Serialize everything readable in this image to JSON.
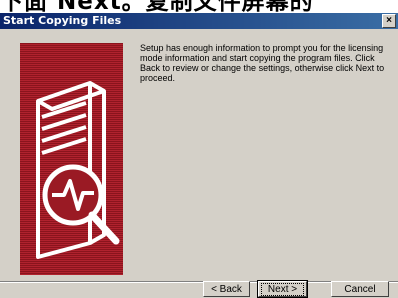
{
  "background_caption": "下面 Next。复制文件屏幕的",
  "window": {
    "title": "Start Copying Files",
    "close_glyph": "×"
  },
  "description": "Setup has enough information to prompt you for the licensing mode information and start copying the program files.  Click Back to review or change the settings, otherwise click Next to proceed.",
  "buttons": {
    "back": "< Back",
    "next": "Next >",
    "cancel": "Cancel"
  },
  "colors": {
    "titlebar": "#0a246a",
    "art": "#9a1a24",
    "face": "#d4d0c8"
  }
}
